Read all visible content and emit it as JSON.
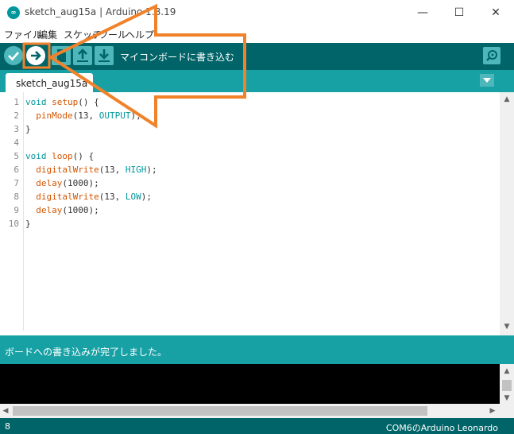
{
  "window": {
    "title": "sketch_aug15a | Arduino 1.8.19",
    "app_icon_text": "∞",
    "minimize": "—",
    "maximize": "☐",
    "close": "✕"
  },
  "menu": [
    "ファイル",
    "編集",
    "スケッチ",
    "ツール",
    "ヘルプ"
  ],
  "toolbar": {
    "hover_label": "マイコンボードに書き込む"
  },
  "tab": {
    "name": "sketch_aug15a",
    "menu_glyph": "▾"
  },
  "code": {
    "line_numbers": [
      "1",
      "2",
      "3",
      "4",
      "5",
      "6",
      "7",
      "8",
      "9",
      "10"
    ]
  },
  "status": {
    "message": "ボードへの書き込みが完了しました。"
  },
  "footer": {
    "line": "8",
    "board": "COM6のArduino Leonardo"
  },
  "colors": {
    "toolbar": "#006468",
    "accent": "#17a1a5",
    "annotation": "#f0822b"
  }
}
